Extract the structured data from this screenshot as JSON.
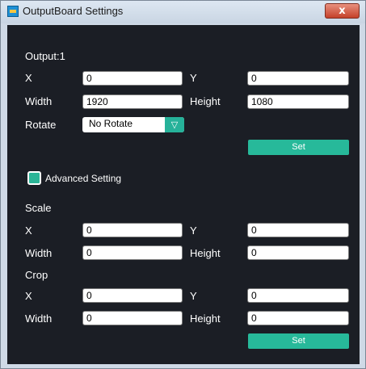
{
  "window": {
    "title": "OutputBoard Settings",
    "close_glyph": "x"
  },
  "output": {
    "heading": "Output:1",
    "x_label": "X",
    "x_value": "0",
    "y_label": "Y",
    "y_value": "0",
    "width_label": "Width",
    "width_value": "1920",
    "height_label": "Height",
    "height_value": "1080",
    "rotate_label": "Rotate",
    "rotate_value": "No Rotate",
    "set_label": "Set"
  },
  "advanced": {
    "label": "Advanced Setting",
    "checked": true
  },
  "scale": {
    "heading": "Scale",
    "x_label": "X",
    "x_value": "0",
    "y_label": "Y",
    "y_value": "0",
    "width_label": "Width",
    "width_value": "0",
    "height_label": "Height",
    "height_value": "0"
  },
  "crop": {
    "heading": "Crop",
    "x_label": "X",
    "x_value": "0",
    "y_label": "Y",
    "y_value": "0",
    "width_label": "Width",
    "width_value": "0",
    "height_label": "Height",
    "height_value": "0",
    "set_label": "Set"
  },
  "colors": {
    "panel_bg": "#1b1e25",
    "accent": "#27b99a"
  }
}
